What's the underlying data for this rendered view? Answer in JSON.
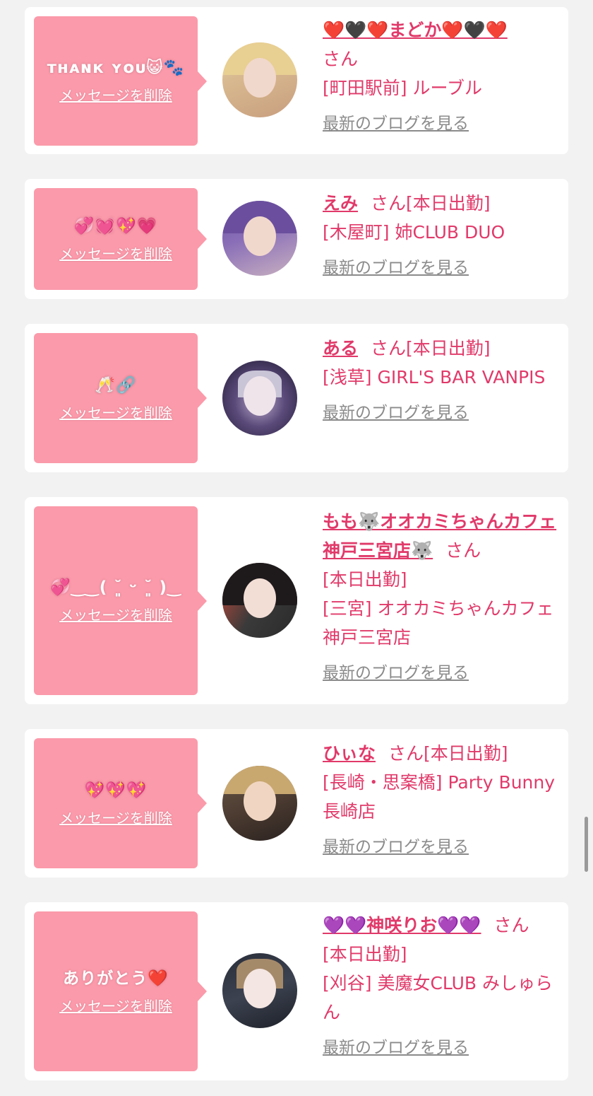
{
  "cards": [
    {
      "message": "тнᴀɴк ʏᴏᴜ😺🐾",
      "delete_label": "メッセージを削除",
      "name": "❤️🖤❤️まどか❤️🖤❤️",
      "san": "さん",
      "status": "",
      "area_shop": "[町田駅前] ルーブル",
      "blog_link": "最新のブログを見る",
      "avatar": "avatar-madoka"
    },
    {
      "message": "💞💓💖💗",
      "delete_label": "メッセージを削除",
      "name": "えみ",
      "san": "さん",
      "status": "[本日出勤]",
      "area_shop": "[木屋町] 姉CLUB DUO",
      "blog_link": "最新のブログを見る",
      "avatar": "avatar-emi"
    },
    {
      "message": "🥂🔗",
      "delete_label": "メッセージを削除",
      "name": "ある",
      "san": "さん",
      "status": "[本日出勤]",
      "area_shop": "[浅草] GIRL'S BAR VANPIS",
      "blog_link": "最新のブログを見る",
      "avatar": "avatar-aru"
    },
    {
      "message": "💞‿‿( ˘͈ ᵕ ˘͈ )‿",
      "delete_label": "メッセージを削除",
      "name": "もも🐺オオカミちゃんカフェ神戸三宮店🐺",
      "san": "さん",
      "status": "[本日出勤]",
      "area_shop": "[三宮] オオカミちゃんカフェ神戸三宮店",
      "blog_link": "最新のブログを見る",
      "avatar": "avatar-momo"
    },
    {
      "message": "💖💖💖",
      "delete_label": "メッセージを削除",
      "name": "ひぃな",
      "san": "さん",
      "status": "[本日出勤]",
      "area_shop": "[長崎・思案橋] Party Bunny 長崎店",
      "blog_link": "最新のブログを見る",
      "avatar": "avatar-hiina"
    },
    {
      "message": "ありがとう❤️",
      "delete_label": "メッセージを削除",
      "name": "💜💜神咲りお💜💜",
      "san": "さん",
      "status": "[本日出勤]",
      "area_shop": "[刈谷] 美魔女CLUB みしゅらん",
      "blog_link": "最新のブログを見る",
      "avatar": "avatar-rio"
    }
  ]
}
